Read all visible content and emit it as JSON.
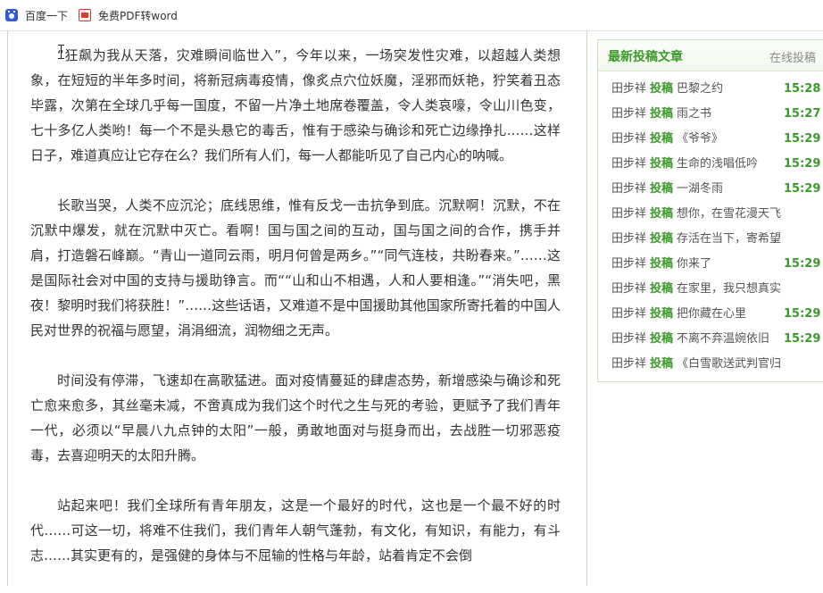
{
  "bookmarks": [
    {
      "label": "百度一下",
      "icon": "baidu-paw-icon"
    },
    {
      "label": "免费PDF转word",
      "icon": "pdf-icon"
    }
  ],
  "article": {
    "paragraphs": [
      "“狂飙为我从天落，灾难瞬间临世入”，今年以来，一场突发性灾难，以超越人类想象，在短短的半年多时间，将新冠病毒疫情，像炙点穴位妖魔，淫邪而妖艳，狞笑着丑态毕露，次第在全球几乎每一国度，不留一片净土地席卷覆盖，令人类哀嚎，令山川色变，七十多亿人类哟！每一个不是头悬它的毒舌，惟有于感染与确诊和死亡边缘挣扎……这样日子，难道真应让它存在么？我们所有人们，每一人都能听见了自己内心的呐喊。",
      "长歌当哭，人类不应沉沦；底线思维，惟有反戈一击抗争到底。沉默啊！沉默，不在沉默中爆发，就在沉默中灭亡。看啊！国与国之间的互动，国与国之间的合作，携手并肩，打造磐石峰巅。“青山一道同云雨，明月何曾是两乡。”“同气连枝，共盼春来。”……这是国际社会对中国的支持与援助铮言。而““山和山不相遇，人和人要相逢。”“消失吧，黑夜！黎明时我们将获胜！”……这些话语，又难道不是中国援助其他国家所寄托着的中国人民对世界的祝福与愿望，涓涓细流，润物细之无声。",
      "时间没有停滞，飞速却在高歌猛进。面对疫情蔓延的肆虐态势，新增感染与确诊和死亡愈来愈多，其丝毫未减，不啻真成为我们这个时代之生与死的考验，更赋予了我们青年一代，必须以“早晨八九点钟的太阳”一般，勇敢地面对与挺身而出，去战胜一切邪恶疫毒，去喜迎明天的太阳升腾。",
      "站起来吧！我们全球所有青年朋友，这是一个最好的时代，这也是一个最不好的时代……可这一切，将难不住我们，我们青年人朝气蓬勃，有文化，有知识，有能力，有斗志……其实更有的，是强健的身体与不屈输的性格与年龄，站着肯定不会倒"
    ]
  },
  "sidebar": {
    "title": "最新投稿文章",
    "link": "在线投稿",
    "items": [
      {
        "author": "田步祥",
        "tag": "投稿",
        "title": "巴黎之约",
        "time": "15:28"
      },
      {
        "author": "田步祥",
        "tag": "投稿",
        "title": "雨之书",
        "time": "15:27"
      },
      {
        "author": "田步祥",
        "tag": "投稿",
        "title": "《爷爷》",
        "time": "15:29"
      },
      {
        "author": "田步祥",
        "tag": "投稿",
        "title": "生命的浅唱低吟",
        "time": "15:29"
      },
      {
        "author": "田步祥",
        "tag": "投稿",
        "title": "一湖冬雨",
        "time": "15:29"
      },
      {
        "author": "田步祥",
        "tag": "投稿",
        "title": "想你，在雪花漫天飞",
        "time": ""
      },
      {
        "author": "田步祥",
        "tag": "投稿",
        "title": "存活在当下，寄希望",
        "time": ""
      },
      {
        "author": "田步祥",
        "tag": "投稿",
        "title": "你来了",
        "time": "15:29"
      },
      {
        "author": "田步祥",
        "tag": "投稿",
        "title": "在家里，我只想真实",
        "time": ""
      },
      {
        "author": "田步祥",
        "tag": "投稿",
        "title": "把你藏在心里",
        "time": "15:29"
      },
      {
        "author": "田步祥",
        "tag": "投稿",
        "title": "不离不弃温婉依旧",
        "time": "15:29"
      },
      {
        "author": "田步祥",
        "tag": "投稿",
        "title": "《白雪歌送武判官归",
        "time": ""
      }
    ]
  },
  "colors": {
    "accent_green": "#3a9a2a",
    "frame_green": "#c8d9c0"
  }
}
